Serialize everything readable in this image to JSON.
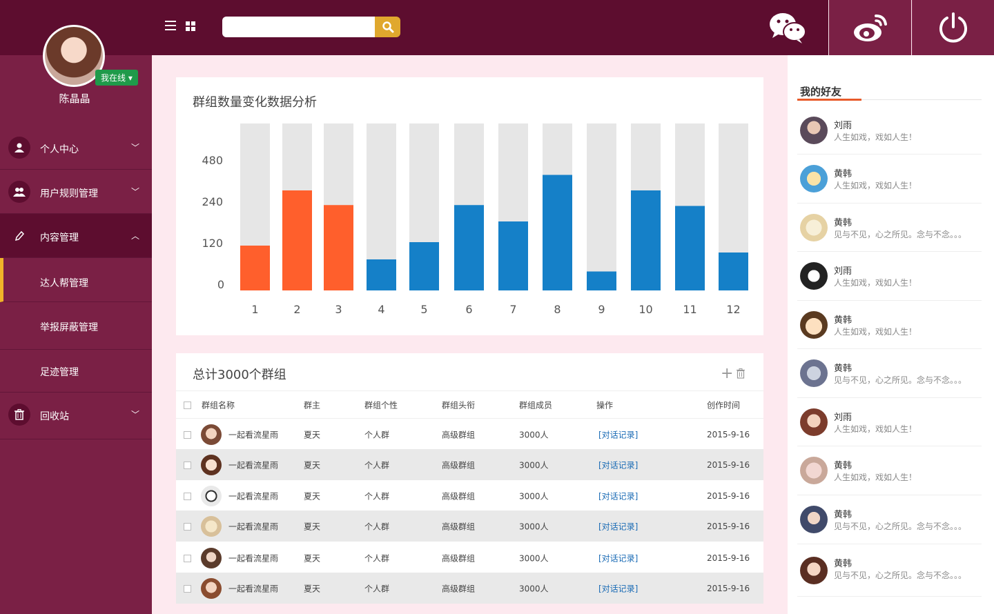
{
  "profile": {
    "name": "陈晶晶",
    "status": "我在线 ▾"
  },
  "sidebar": {
    "items": [
      {
        "label": "个人中心"
      },
      {
        "label": "用户规则管理"
      },
      {
        "label": "内容管理"
      },
      {
        "label": "回收站"
      }
    ],
    "subitems": [
      {
        "label": "达人帮管理"
      },
      {
        "label": "举报屏蔽管理"
      },
      {
        "label": "足迹管理"
      }
    ]
  },
  "search": {
    "placeholder": "",
    "value": ""
  },
  "chart_section": {
    "title": "群组数量变化数据分析"
  },
  "chart_data": {
    "type": "bar",
    "title": "群组数量变化数据分析",
    "categories": [
      "1",
      "2",
      "3",
      "4",
      "5",
      "6",
      "7",
      "8",
      "9",
      "10",
      "11",
      "12"
    ],
    "values": [
      130,
      340,
      255,
      90,
      140,
      255,
      200,
      430,
      55,
      340,
      250,
      110
    ],
    "max": 480,
    "yticks": [
      "480",
      "240",
      "120",
      "0"
    ],
    "colors": {
      "highlight": "#ff5f2c",
      "normal": "#1580c8",
      "track": "#e6e6e6"
    },
    "highlight_count": 3
  },
  "table": {
    "title": "总计3000个群组",
    "headers": [
      "群组名称",
      "群主",
      "群组个性",
      "群组头衔",
      "群组成员",
      "操作",
      "创作时间"
    ],
    "rows": [
      {
        "name": "一起看流星雨",
        "owner": "夏天",
        "personality": "个人群",
        "title": "高级群组",
        "members": "3000人",
        "action": "[对话记录]",
        "time": "2015-9-16"
      },
      {
        "name": "一起看流星雨",
        "owner": "夏天",
        "personality": "个人群",
        "title": "高级群组",
        "members": "3000人",
        "action": "[对话记录]",
        "time": "2015-9-16"
      },
      {
        "name": "一起看流星雨",
        "owner": "夏天",
        "personality": "个人群",
        "title": "高级群组",
        "members": "3000人",
        "action": "[对话记录]",
        "time": "2015-9-16"
      },
      {
        "name": "一起看流星雨",
        "owner": "夏天",
        "personality": "个人群",
        "title": "高级群组",
        "members": "3000人",
        "action": "[对话记录]",
        "time": "2015-9-16"
      },
      {
        "name": "一起看流星雨",
        "owner": "夏天",
        "personality": "个人群",
        "title": "高级群组",
        "members": "3000人",
        "action": "[对话记录]",
        "time": "2015-9-16"
      },
      {
        "name": "一起看流星雨",
        "owner": "夏天",
        "personality": "个人群",
        "title": "高级群组",
        "members": "3000人",
        "action": "[对话记录]",
        "time": "2015-9-16"
      }
    ]
  },
  "friends": {
    "title": "我的好友",
    "list": [
      {
        "name": "刘雨",
        "msg": "人生如戏，戏如人生！"
      },
      {
        "name": "黄韩",
        "msg": "人生如戏，戏如人生！"
      },
      {
        "name": "黄韩",
        "msg": "见与不见，心之所见。念与不念。。。"
      },
      {
        "name": "刘雨",
        "msg": "人生如戏，戏如人生！"
      },
      {
        "name": "黄韩",
        "msg": "人生如戏，戏如人生！"
      },
      {
        "name": "黄韩",
        "msg": "见与不见，心之所见。念与不念。。。"
      },
      {
        "name": "刘雨",
        "msg": "人生如戏，戏如人生！"
      },
      {
        "name": "黄韩",
        "msg": "人生如戏，戏如人生！"
      },
      {
        "name": "黄韩",
        "msg": "见与不见，心之所见。念与不念。。。"
      },
      {
        "name": "黄韩",
        "msg": "见与不见，心之所见。念与不念。。。"
      }
    ]
  }
}
